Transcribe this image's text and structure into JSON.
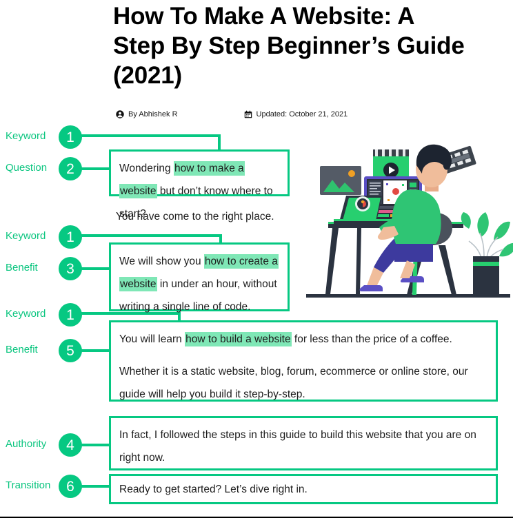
{
  "article": {
    "title": "How To Make A Website: A Step By Step Beginner’s Guide (2021)",
    "byline": {
      "author_icon": "person-icon",
      "author": "By Abhishek R",
      "date_icon": "calendar-icon",
      "date": "Updated: October 21, 2021"
    }
  },
  "colors": {
    "accent_green": "#06c882",
    "highlight_green": "#7fe7b6",
    "text": "#1c1c1c",
    "title": "#000000"
  },
  "body": {
    "intro_question_pre": "Wondering ",
    "intro_question_keyword": "how to make a website",
    "intro_question_post": " but don’t know where to start?",
    "right_place": "You have come to the right place.",
    "benefit_one_pre": "We will show you ",
    "benefit_one_keyword": "how to create a website",
    "benefit_one_post": " in under an hour, without writing a single line of code.",
    "benefit_two_pre": "You will learn ",
    "benefit_two_keyword": "how to build a website",
    "benefit_two_post": " for less than the price of a coffee.",
    "benefit_two_second": "Whether it is a static website, blog, forum, ecommerce or online store, our guide will help you build it step-by-step.",
    "authority": "In fact, I followed the steps in this guide to build this website that you are on right now.",
    "transition": "Ready to get started? Let’s dive right in."
  },
  "annotations": [
    {
      "label": "Keyword",
      "number": "1"
    },
    {
      "label": "Question",
      "number": "2"
    },
    {
      "label": "Keyword",
      "number": "1"
    },
    {
      "label": "Benefit",
      "number": "3"
    },
    {
      "label": "Keyword",
      "number": "1"
    },
    {
      "label": "Benefit",
      "number": "5"
    },
    {
      "label": "Authority",
      "number": "4"
    },
    {
      "label": "Transition",
      "number": "6"
    }
  ],
  "illustration": {
    "name": "person-at-desk-video-editing-illustration",
    "elements": [
      "image-placeholder-icon",
      "video-player-icon",
      "film-strip-icon",
      "desktop-monitor",
      "laptop",
      "desk",
      "office-chair",
      "potted-plant",
      "seated-person"
    ]
  }
}
